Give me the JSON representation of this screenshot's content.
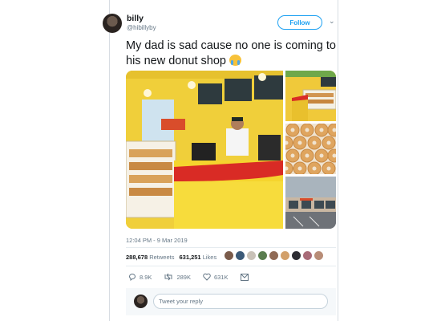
{
  "user": {
    "name": "billy",
    "handle": "@hibillyby"
  },
  "follow_label": "Follow",
  "tweet": {
    "text": "My dad is sad cause no one is coming to his new donut shop"
  },
  "timestamp": "12:04 PM - 9 Mar 2019",
  "stats": {
    "retweets_count": "288,678",
    "retweets_label": "Retweets",
    "likes_count": "631,251",
    "likes_label": "Likes"
  },
  "actions": {
    "replies": "8.9K",
    "retweets": "289K",
    "likes": "631K"
  },
  "reply_placeholder": "Tweet your reply",
  "colors": {
    "accent": "#1da1f2",
    "muted": "#657786",
    "shop_yellow": "#f2d33a",
    "counter_red": "#d92b25"
  }
}
